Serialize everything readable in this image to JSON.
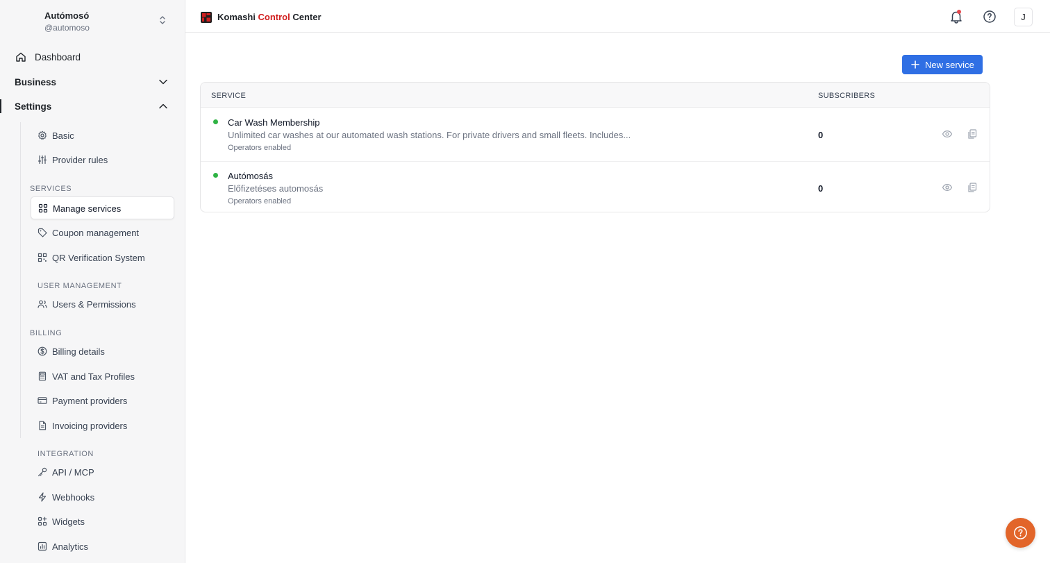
{
  "org": {
    "name": "Autómosó",
    "handle": "@automoso"
  },
  "nav": {
    "dashboard": "Dashboard",
    "business": "Business",
    "settings": "Settings",
    "basic": "Basic",
    "provider_rules": "Provider rules"
  },
  "sections": {
    "services": {
      "heading": "SERVICES",
      "items": [
        "Manage services",
        "Coupon management",
        "QR Verification System"
      ]
    },
    "user_management": {
      "heading": "USER MANAGEMENT",
      "items": [
        "Users & Permissions"
      ]
    },
    "billing": {
      "heading": "BILLING",
      "items": [
        "Billing details",
        "VAT and Tax Profiles",
        "Payment providers",
        "Invoicing providers"
      ]
    },
    "integration": {
      "heading": "INTEGRATION",
      "items": [
        "API / MCP",
        "Webhooks",
        "Widgets",
        "Analytics"
      ]
    }
  },
  "header": {
    "brand_part1": "Komashi ",
    "brand_part2": "Control",
    "brand_part3": " Center",
    "avatar_initial": "J",
    "brand_accent_color": "#d11f1f"
  },
  "main": {
    "new_service_label": "New service",
    "table": {
      "col_service": "SERVICE",
      "col_subscribers": "SUBSCRIBERS",
      "rows": [
        {
          "name": "Car Wash Membership",
          "description": "Unlimited car washes at our automated wash stations. For private drivers and small fleets. Includes...",
          "meta": "Operators enabled",
          "subscribers": "0"
        },
        {
          "name": "Autómosás",
          "description": "Előfizetéses automosás",
          "meta": "Operators enabled",
          "subscribers": "0"
        }
      ]
    }
  },
  "colors": {
    "primary": "#2f6fe4",
    "status_active": "#2fb344",
    "help_fab": "#e2652a"
  }
}
